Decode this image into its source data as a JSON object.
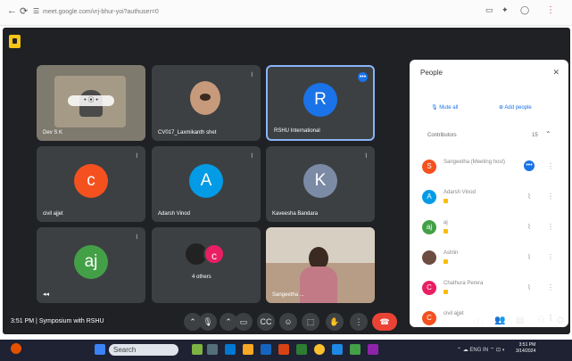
{
  "browser": {
    "url": "meet.google.com/vrj-bhur-yoi?authuser=0",
    "icons": [
      "back-icon",
      "reload-icon",
      "site-info-icon",
      "cast-icon",
      "extensions-icon",
      "profile-icon",
      "menu-icon"
    ]
  },
  "colors": {
    "meet_bg": "#1f2124",
    "tile_bg": "#3c4043",
    "accent": "#8ab4f8",
    "end_call": "#ea4335"
  },
  "tiles": [
    {
      "name": "Dev S K",
      "type": "video"
    },
    {
      "name": "CV017_Laxmikanth shet",
      "type": "video"
    },
    {
      "name": "RSHU International",
      "initial": "R",
      "color": "#1a73e8"
    },
    {
      "name": "civil ajjet",
      "initial": "c",
      "color": "#f4511e"
    },
    {
      "name": "Adarsh Vinod",
      "initial": "A",
      "color": "#039be5"
    },
    {
      "name": "Kaveesha Bandara",
      "initial": "K",
      "color": "#7c8ba5"
    },
    {
      "name": "",
      "initial": "aj",
      "color": "#43a047"
    },
    {
      "name": "4 others",
      "initial": "c",
      "color": "#e91e63"
    },
    {
      "name": "Sangeetha ...",
      "type": "video"
    }
  ],
  "people": {
    "title": "People",
    "add_people": "Add people",
    "mute_all": "Mute all",
    "section": "Contributors",
    "count": "15",
    "rows": [
      {
        "initial": "S",
        "color": "#f4511e",
        "name": "Sangeetha (Meeting host)"
      },
      {
        "initial": "A",
        "color": "#039be5",
        "name": "Adarsh Vinod"
      },
      {
        "initial": "aj",
        "color": "#43a047",
        "name": "aj"
      },
      {
        "initial": "",
        "color": "#6d4c41",
        "name": "Ashlin"
      },
      {
        "initial": "C",
        "color": "#e91e63",
        "name": "Chathura Perera"
      },
      {
        "initial": "C",
        "color": "#f4511e",
        "name": "civil ajjet"
      }
    ]
  },
  "meeting": {
    "time": "3:51 PM",
    "separator": "|",
    "title": "Symposium with RSHU"
  },
  "taskbar": {
    "search": "Search",
    "lang": "ENG IN",
    "clock_time": "3:51 PM",
    "clock_date": "3/14/2024"
  }
}
